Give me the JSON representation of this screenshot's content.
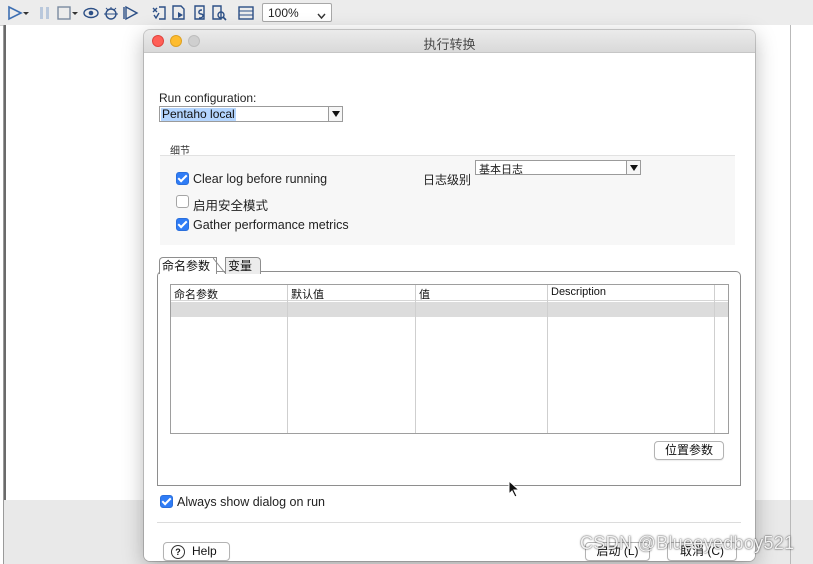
{
  "toolbar": {
    "icons": [
      "run-icon",
      "dropdown-arrow-icon",
      "pause-icon",
      "stop-icon",
      "dropdown-arrow-icon",
      "preview-icon",
      "debug-icon",
      "replay-icon",
      "check-transformation-icon",
      "impact-analysis-icon",
      "sql-icon",
      "explore-db-icon",
      "show-results-icon"
    ],
    "zoom_value": "100%"
  },
  "dialog": {
    "title": "执行转换",
    "run_configuration_label": "Run configuration:",
    "run_configuration_value": "Pentaho local",
    "details_group_title": "细节",
    "clear_log_label": "Clear log before running",
    "clear_log_checked": true,
    "safe_mode_label": "启用安全模式",
    "safe_mode_checked": false,
    "gather_metrics_label": "Gather performance metrics",
    "gather_metrics_checked": true,
    "log_level_label": "日志级别",
    "log_level_value": "基本日志",
    "tabs": [
      {
        "label": "命名参数",
        "active": true
      },
      {
        "label": "变量",
        "active": false
      }
    ],
    "table": {
      "columns": [
        "命名参数",
        "默认值",
        "值",
        "Description"
      ]
    },
    "position_params_button": "位置参数",
    "always_show_label": "Always show dialog on run",
    "always_show_checked": true,
    "help_button": "Help",
    "help_icon_glyph": "?",
    "start_button": "启动 (L)",
    "cancel_button": "取消 (C)"
  },
  "watermark": "CSDN @Blueeyedboy521",
  "colors": {
    "accent": "#2f7cf6",
    "selection": "#b4d5fe",
    "traffic_close": "#ff5f57",
    "traffic_min": "#febc2e"
  }
}
